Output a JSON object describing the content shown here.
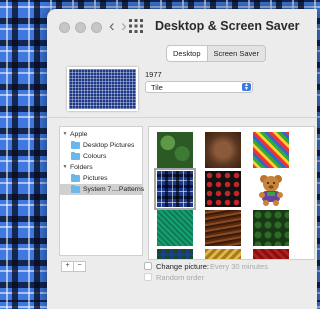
{
  "window": {
    "title": "Desktop & Screen Saver",
    "tabs": [
      {
        "label": "Desktop",
        "active": true
      },
      {
        "label": "Screen Saver",
        "active": false
      }
    ]
  },
  "preview": {
    "name": "1977",
    "fit_option": "Tile"
  },
  "sidebar": {
    "sections": [
      {
        "label": "Apple",
        "items": [
          {
            "label": "Desktop Pictures"
          },
          {
            "label": "Colours"
          }
        ]
      },
      {
        "label": "Folders",
        "items": [
          {
            "label": "Pictures"
          },
          {
            "label": "System 7....Patterns",
            "selected": true
          }
        ]
      }
    ],
    "add_label": "+",
    "remove_label": "−"
  },
  "thumbnails": [
    {
      "pattern": "green-foliage"
    },
    {
      "pattern": "brown-leather"
    },
    {
      "pattern": "colorful-yarn"
    },
    {
      "pattern": "blue-plaid",
      "selected": true
    },
    {
      "pattern": "red-roses-on-black"
    },
    {
      "pattern": "teddy-bear"
    },
    {
      "pattern": "green-diagonal-weave"
    },
    {
      "pattern": "brown-wood-grain"
    },
    {
      "pattern": "dark-green-paisley"
    },
    {
      "pattern": "green-tartan"
    },
    {
      "pattern": "gold-embossed"
    },
    {
      "pattern": "red-fabric"
    }
  ],
  "options": {
    "change_picture_label": "Change picture:",
    "change_interval": "Every 30 minutes",
    "random_order_label": "Random order"
  },
  "colors": {
    "accent": "#3e7ae0",
    "window_bg": "#ececec",
    "selection": "#d0d0d0"
  }
}
